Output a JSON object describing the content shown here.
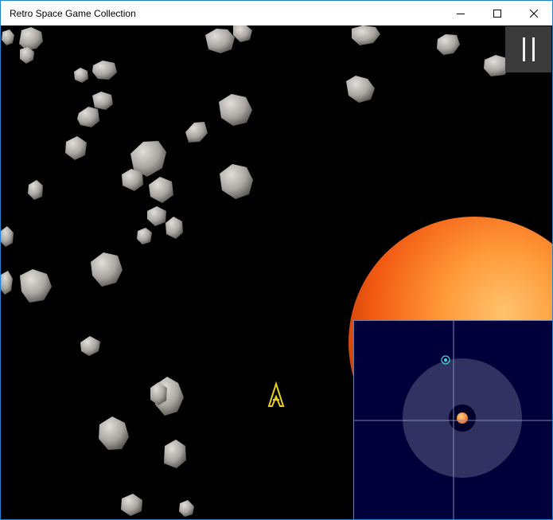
{
  "window": {
    "title": "Retro Space Game Collection",
    "controls": [
      "minimize-icon",
      "maximize-icon",
      "close-icon"
    ]
  },
  "game": {
    "background_color": "#000000",
    "hud": {
      "pause_icon": "pause-icon"
    },
    "player_ship": {
      "color": "#e8d021"
    },
    "sun": {
      "color": "#f36a1b"
    },
    "minimap": {
      "background": "#02003a",
      "grid_color": "#8a95c0",
      "player_marker_color": "#4fd1d1"
    }
  }
}
